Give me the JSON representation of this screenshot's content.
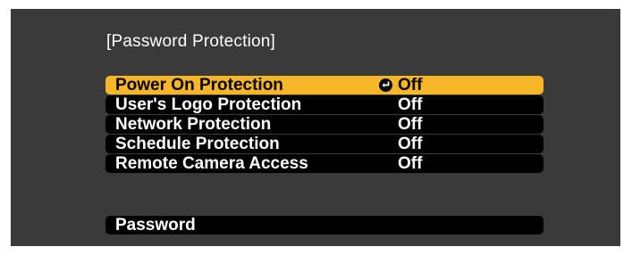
{
  "screen": {
    "title": "[Password Protection]"
  },
  "menu": {
    "items": [
      {
        "label": "Power On Protection",
        "value": "Off",
        "selected": true
      },
      {
        "label": "User's Logo Protection",
        "value": "Off",
        "selected": false
      },
      {
        "label": "Network Protection",
        "value": "Off",
        "selected": false
      },
      {
        "label": "Schedule Protection",
        "value": "Off",
        "selected": false
      },
      {
        "label": "Remote Camera Access",
        "value": "Off",
        "selected": false
      }
    ],
    "password_label": "Password"
  },
  "colors": {
    "background": "#3a3a3a",
    "row": "#000000",
    "highlight": "#f6b626",
    "text": "#ffffff"
  },
  "icons": {
    "enter": "enter-icon"
  }
}
